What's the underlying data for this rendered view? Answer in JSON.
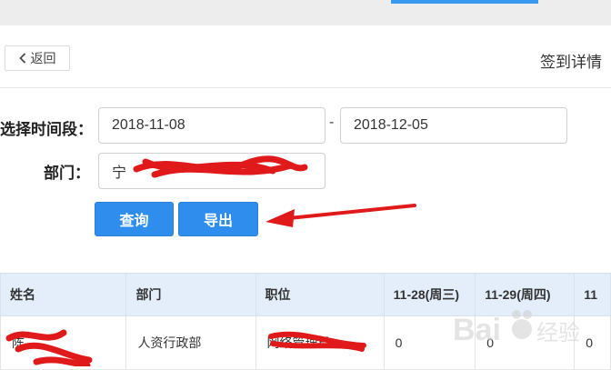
{
  "header": {
    "back_label": "返回",
    "title": "签到详情"
  },
  "filters": {
    "time_label": "选择时间段：",
    "start_date": "2018-11-08",
    "end_date": "2018-12-05",
    "range_separator": "-",
    "dept_label": "部门：",
    "dept_value": "宁"
  },
  "actions": {
    "query_label": "查询",
    "export_label": "导出"
  },
  "table": {
    "columns": [
      "姓名",
      "部门",
      "职位",
      "11-28(周三)",
      "11-29(周四)",
      "11"
    ],
    "rows": [
      {
        "name": "陈",
        "department": "人资行政部",
        "position": "网络管理员",
        "d1": "0",
        "d2": "0",
        "d3": "0"
      }
    ]
  },
  "watermark": {
    "brand": "Baidu",
    "suffix": "经验"
  },
  "colors": {
    "primary": "#2f8ded",
    "header_bg": "#e3eefa",
    "annotation": "#e01a1a",
    "topbar_accent": "#3a9af0"
  }
}
